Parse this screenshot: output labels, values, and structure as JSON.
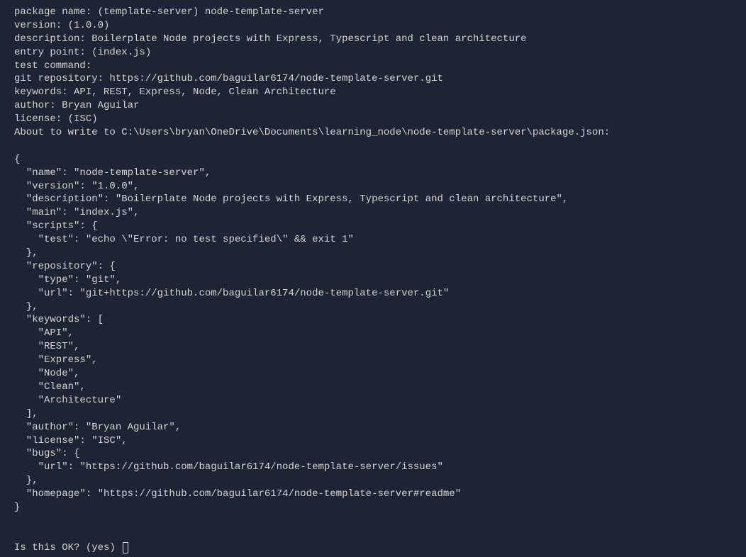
{
  "prompts": {
    "package_name": "package name: (template-server) node-template-server",
    "version": "version: (1.0.0)",
    "description": "description: Boilerplate Node projects with Express, Typescript and clean architecture",
    "entry_point": "entry point: (index.js)",
    "test_command": "test command:",
    "git_repository": "git repository: https://github.com/baguilar6174/node-template-server.git",
    "keywords": "keywords: API, REST, Express, Node, Clean Architecture",
    "author": "author: Bryan Aguilar",
    "license": "license: (ISC)",
    "about_to_write": "About to write to C:\\Users\\bryan\\OneDrive\\Documents\\learning_node\\node-template-server\\package.json:"
  },
  "json_output": {
    "line1": "{",
    "line2": "  \"name\": \"node-template-server\",",
    "line3": "  \"version\": \"1.0.0\",",
    "line4": "  \"description\": \"Boilerplate Node projects with Express, Typescript and clean architecture\",",
    "line5": "  \"main\": \"index.js\",",
    "line6": "  \"scripts\": {",
    "line7": "    \"test\": \"echo \\\"Error: no test specified\\\" && exit 1\"",
    "line8": "  },",
    "line9": "  \"repository\": {",
    "line10": "    \"type\": \"git\",",
    "line11": "    \"url\": \"git+https://github.com/baguilar6174/node-template-server.git\"",
    "line12": "  },",
    "line13": "  \"keywords\": [",
    "line14": "    \"API\",",
    "line15": "    \"REST\",",
    "line16": "    \"Express\",",
    "line17": "    \"Node\",",
    "line18": "    \"Clean\",",
    "line19": "    \"Architecture\"",
    "line20": "  ],",
    "line21": "  \"author\": \"Bryan Aguilar\",",
    "line22": "  \"license\": \"ISC\",",
    "line23": "  \"bugs\": {",
    "line24": "    \"url\": \"https://github.com/baguilar6174/node-template-server/issues\"",
    "line25": "  },",
    "line26": "  \"homepage\": \"https://github.com/baguilar6174/node-template-server#readme\"",
    "line27": "}"
  },
  "confirm": {
    "prompt": "Is this OK? (yes) "
  }
}
